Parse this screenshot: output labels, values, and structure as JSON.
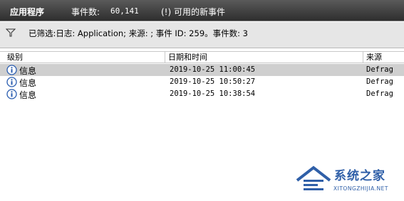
{
  "header_bar": {
    "log_name": "应用程序",
    "event_count_label": "事件数:",
    "event_count_value": "60,141",
    "event_count_note": "(!) 可用的新事件"
  },
  "filter": {
    "text": "已筛选:日志: Application; 来源: ; 事件 ID: 259。事件数: 3"
  },
  "columns": {
    "level": "级别",
    "date_time": "日期和时间",
    "source": "来源"
  },
  "rows": [
    {
      "level": "信息",
      "date_time": "2019-10-25 11:00:45",
      "source": "Defrag",
      "selected": true
    },
    {
      "level": "信息",
      "date_time": "2019-10-25 10:50:27",
      "source": "Defrag",
      "selected": false
    },
    {
      "level": "信息",
      "date_time": "2019-10-25 10:38:54",
      "source": "Defrag",
      "selected": false
    }
  ],
  "icons": {
    "filter": "funnel-icon",
    "info": "info-icon"
  },
  "watermark": {
    "name": "系统之家",
    "url": "XITONGZHIJIA.NET"
  },
  "colors": {
    "title_bar": "#3c3c3c",
    "filter_bar": "#e6e6e6",
    "selected_row": "#cfcfcf",
    "info_icon": "#2a5db0",
    "watermark": "#2f5fa8"
  }
}
